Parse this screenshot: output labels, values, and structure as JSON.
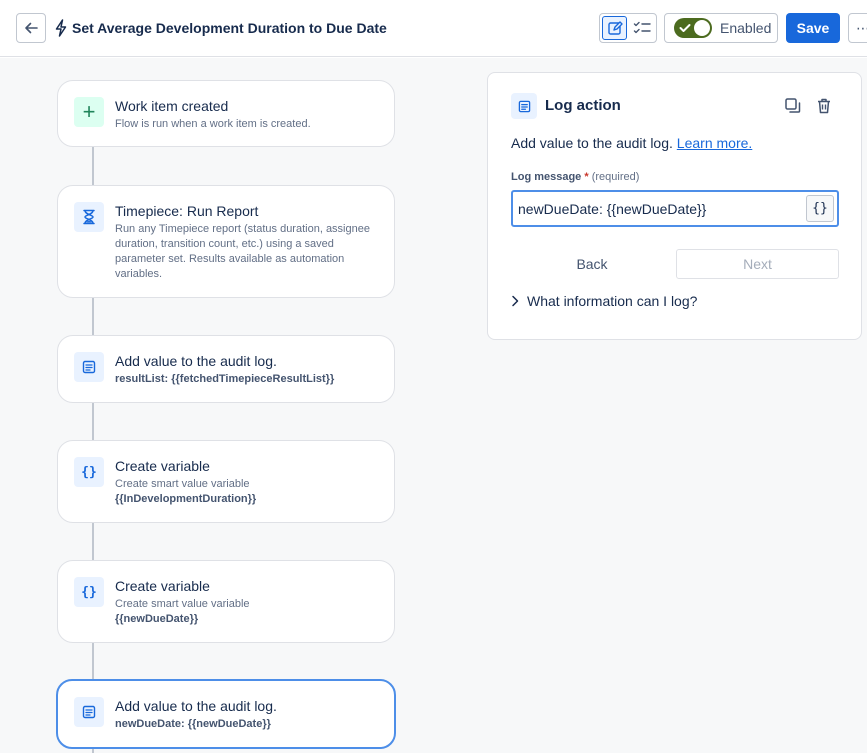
{
  "header": {
    "title": "Set Average Development Duration to Due Date",
    "enabled_label": "Enabled",
    "save_label": "Save",
    "more_label": "⋯"
  },
  "flow": {
    "nodes": [
      {
        "title": "Work item created",
        "description": "Flow is run when a work item is created.",
        "icon": "plus-icon"
      },
      {
        "title": "Timepiece: Run Report",
        "description": "Run any Timepiece report (status duration, assignee duration, transition count, etc.) using a saved parameter set. Results available as automation variables.",
        "icon": "hourglass-icon"
      },
      {
        "title": "Add value to the audit log.",
        "subtitle": "resultList: {{fetchedTimepieceResultList}}",
        "icon": "log-icon"
      },
      {
        "title": "Create variable",
        "description": "Create smart value variable",
        "variable": "{{InDevelopmentDuration}}",
        "icon": "braces-icon"
      },
      {
        "title": "Create variable",
        "description": "Create smart value variable",
        "variable": "{{newDueDate}}",
        "icon": "braces-icon"
      },
      {
        "title": "Add value to the audit log.",
        "subtitle": "newDueDate: {{newDueDate}}",
        "icon": "log-icon"
      }
    ],
    "brace_glyph": "{}"
  },
  "panel": {
    "title": "Log action",
    "description": "Add value to the audit log.",
    "learn_more": "Learn more.",
    "field_label": "Log message",
    "required_star": "*",
    "required_text": "(required)",
    "field_value": "newDueDate: {{newDueDate}}",
    "brace_button": "{}",
    "back_label": "Back",
    "next_label": "Next",
    "expander_label": "What information can I log?"
  },
  "colors": {
    "brand": "#1868db",
    "toggle_on": "#4c6b1f",
    "selected_border": "#4d8ee8"
  }
}
